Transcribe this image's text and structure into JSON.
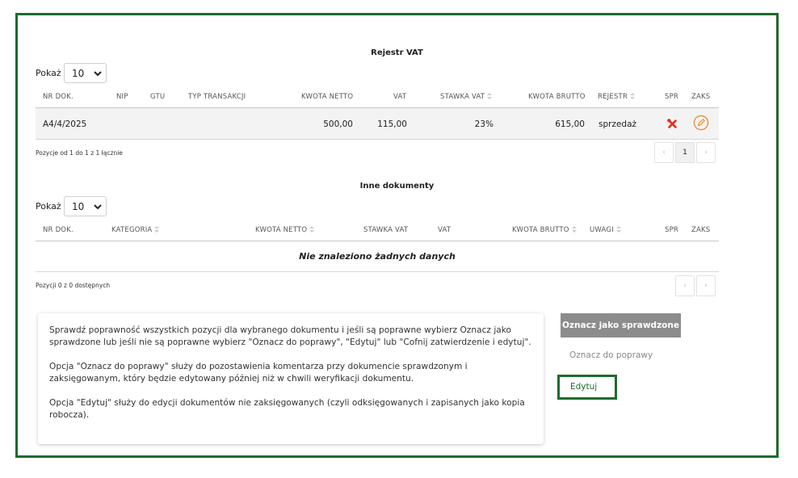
{
  "vat": {
    "title": "Rejestr VAT",
    "show_label": "Pokaż",
    "page_size": "10",
    "columns": {
      "nr": "NR DOK.",
      "nip": "NIP",
      "gtu": "GTU",
      "typ": "TYP TRANSAKCJI",
      "netto": "KWOTA NETTO",
      "vat": "VAT",
      "stawka": "STAWKA VAT",
      "brutto": "KWOTA BRUTTO",
      "rejestr": "REJESTR",
      "spr": "SPR",
      "zaks": "ZAKS"
    },
    "rows": [
      {
        "nr": "A4/4/2025",
        "nip": "",
        "gtu": "",
        "typ": "",
        "netto": "500,00",
        "vat": "115,00",
        "stawka": "23%",
        "brutto": "615,00",
        "rejestr": "sprzedaż"
      }
    ],
    "info": "Pozycje od 1 do 1 z 1 łącznie",
    "pager": {
      "prev": "‹",
      "current": "1",
      "next": "›"
    }
  },
  "inne": {
    "title": "Inne dokumenty",
    "show_label": "Pokaż",
    "page_size": "10",
    "columns": {
      "nr": "NR DOK.",
      "kategoria": "KATEGORIA",
      "netto": "KWOTA NETTO",
      "stawka": "STAWKA VAT",
      "vat": "VAT",
      "brutto": "KWOTA BRUTTO",
      "uwagi": "UWAGI",
      "spr": "SPR",
      "zaks": "ZAKS"
    },
    "empty": "Nie znaleziono żadnych danych",
    "info": "Pozycji 0 z 0 dostępnych",
    "pager": {
      "prev": "‹",
      "next": "›"
    }
  },
  "help": {
    "p1": "Sprawdź poprawność wszystkich pozycji dla wybranego dokumentu i jeśli są poprawne wybierz Oznacz jako sprawdzone lub jeśli nie są poprawne wybierz \"Oznacz do poprawy\", \"Edytuj\" lub \"Cofnij zatwierdzenie i edytuj\".",
    "p2": "Opcja \"Oznacz do poprawy\" służy do pozostawienia komentarza przy dokumencie sprawdzonym i zaksięgowanym, który będzie edytowany później niż w chwili weryfikacji dokumentu.",
    "p3": "Opcja \"Edytuj\" służy do edycji dokumentów nie zaksięgowanych (czyli odksięgowanych i zapisanych jako kopia robocza)."
  },
  "actions": {
    "mark_checked": "Oznacz jako sprawdzone",
    "mark_fix": "Oznacz do poprawy",
    "edit": "Edytuj"
  },
  "colors": {
    "frame": "#1c6b2c",
    "tool_icon": "#e0321e",
    "edit_icon": "#e8923a"
  }
}
